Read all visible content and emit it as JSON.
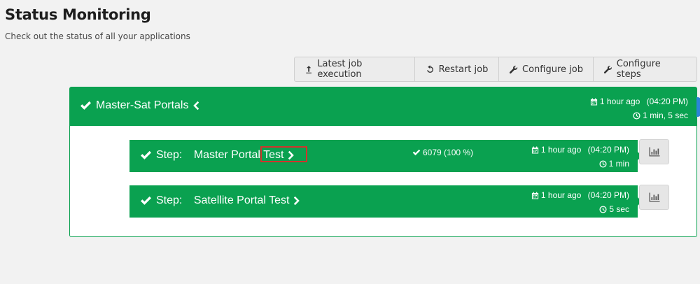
{
  "page": {
    "title": "Status Monitoring",
    "subtitle": "Check out the status of all your applications"
  },
  "toolbar": {
    "latest_job_execution": "Latest job execution",
    "restart_job": "Restart job",
    "configure_job": "Configure job",
    "configure_steps": "Configure steps"
  },
  "job": {
    "name": "Master-Sat Portals",
    "status": "success",
    "started": "1 hour ago",
    "started_time": "(04:20 PM)",
    "duration": "1 min, 5 sec"
  },
  "steps": [
    {
      "prefix": "Step:",
      "name": "Master Portal Test",
      "count": "6079 (100 %)",
      "started": "1 hour ago",
      "started_time": "(04:20 PM)",
      "duration": "1 min"
    },
    {
      "prefix": "Step:",
      "name": "Satellite Portal Test",
      "started": "1 hour ago",
      "started_time": "(04:20 PM)",
      "duration": "5 sec"
    }
  ],
  "colors": {
    "success": "#0aa150",
    "highlight": "#d0342c",
    "accent": "#2b84d8"
  },
  "icons": [
    "upload-icon",
    "undo-icon",
    "wrench-icon",
    "check-icon",
    "chevron-left-icon",
    "chevron-right-icon",
    "calendar-icon",
    "clock-icon",
    "bar-chart-icon"
  ]
}
